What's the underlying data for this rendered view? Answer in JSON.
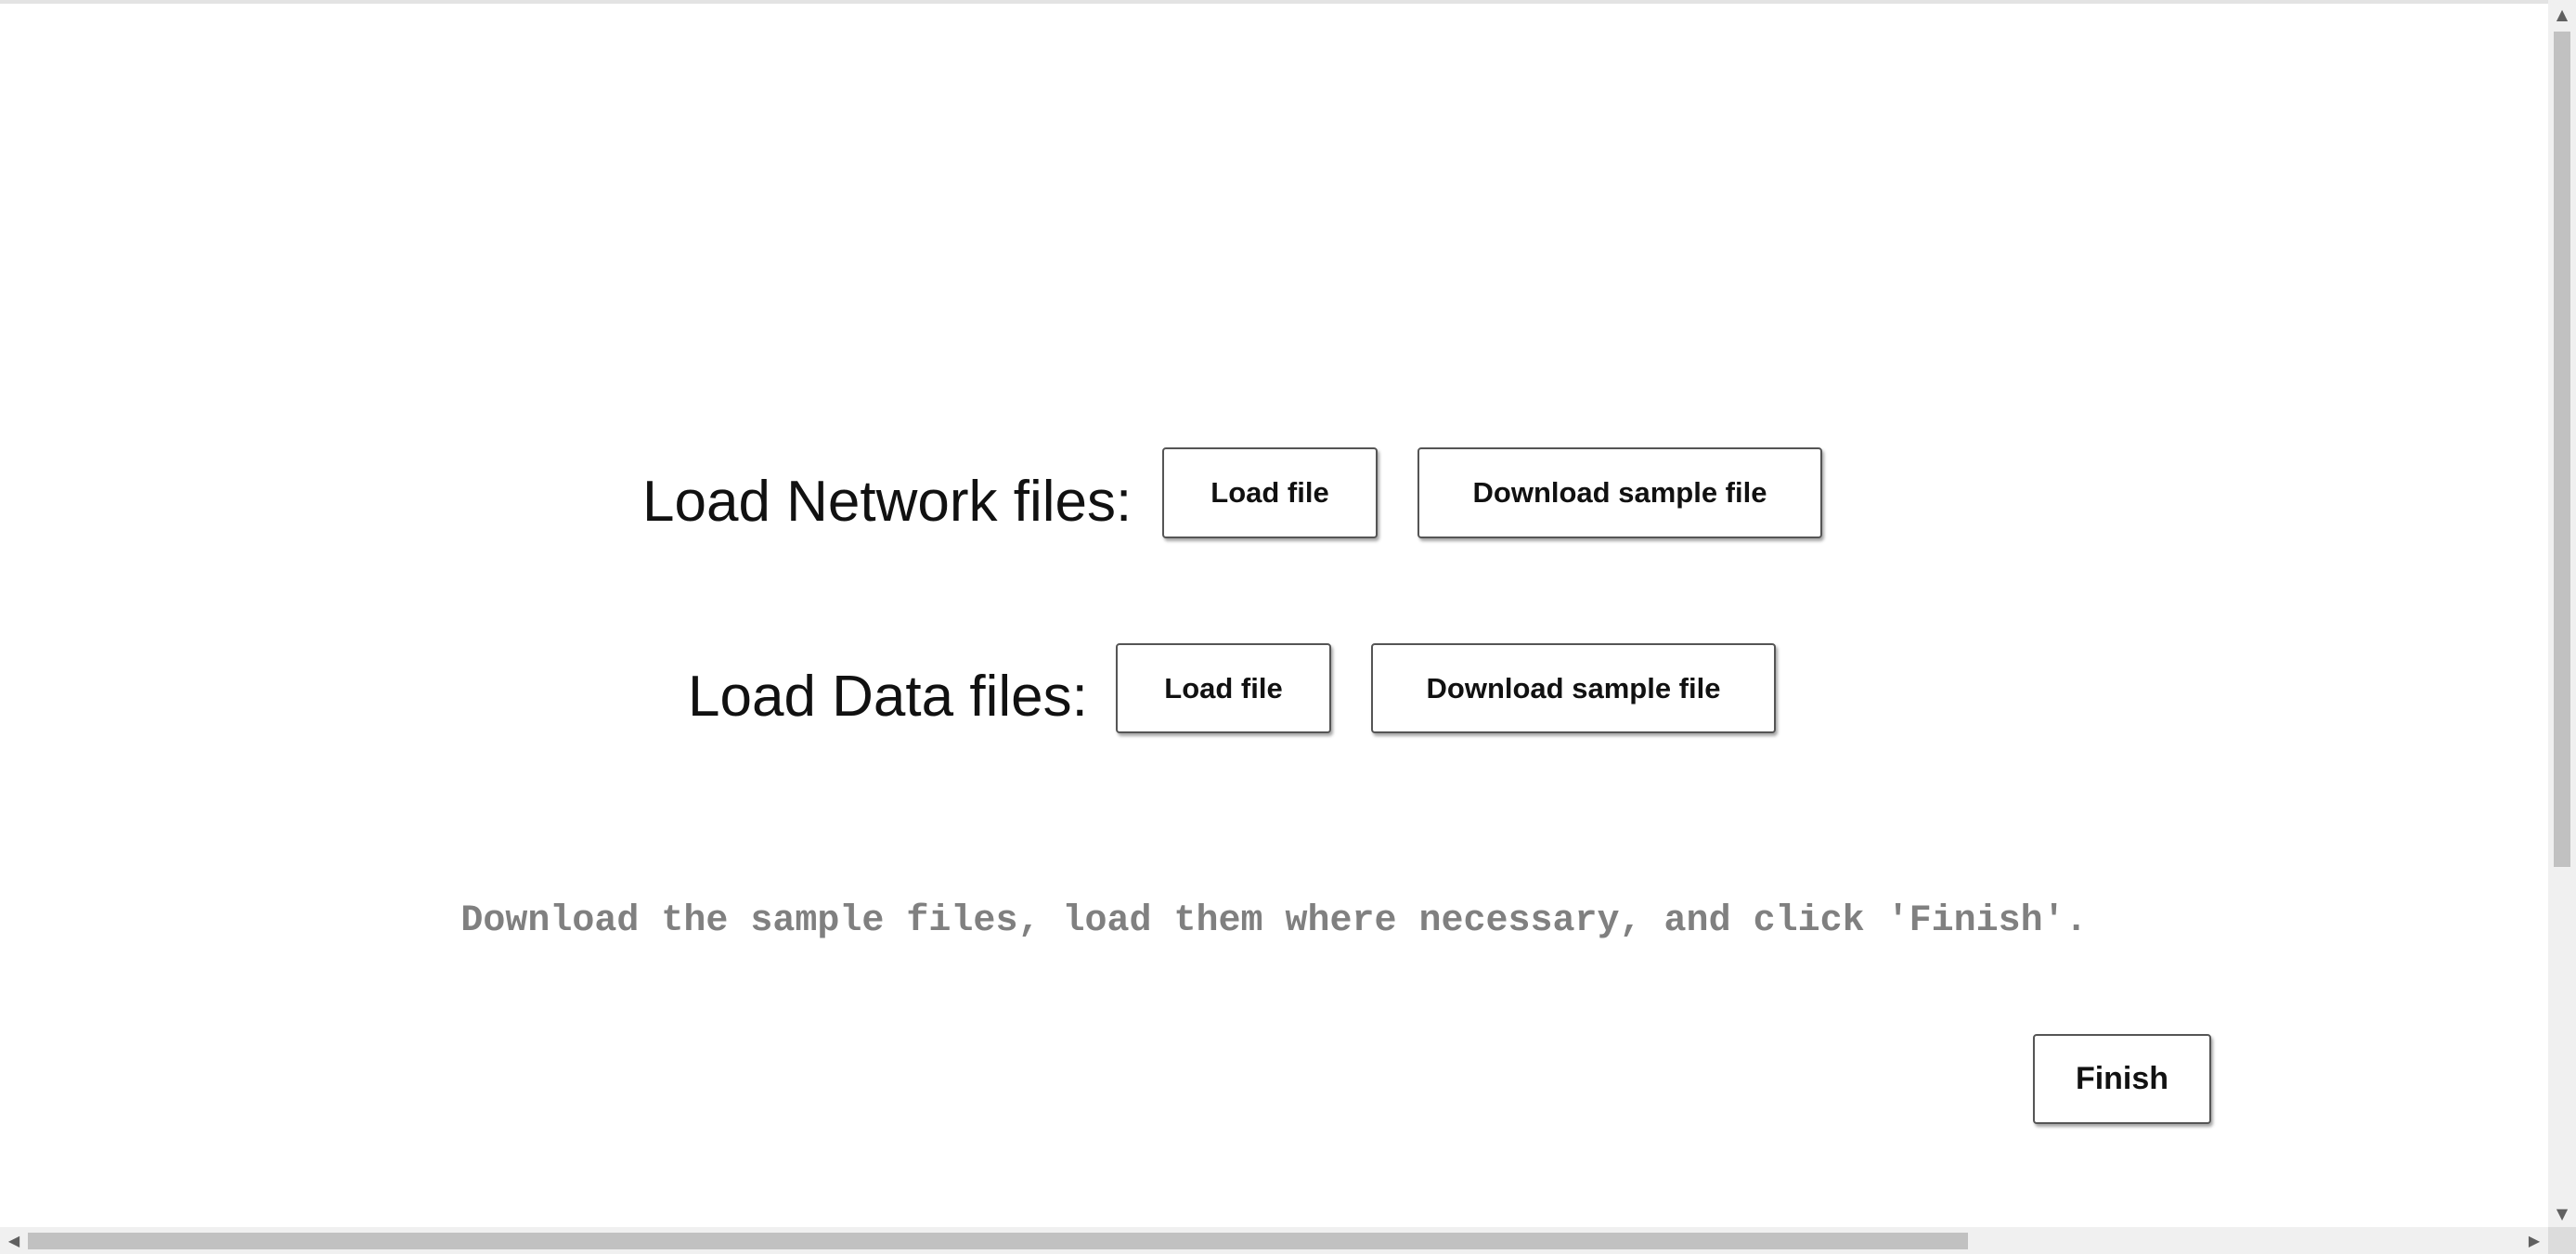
{
  "network": {
    "label": "Load Network files:",
    "load_button": "Load file",
    "download_button": "Download sample file"
  },
  "data": {
    "label": "Load Data files:",
    "load_button": "Load file",
    "download_button": "Download sample file"
  },
  "instruction": "Download the sample files, load them where necessary, and click 'Finish'.",
  "finish_button": "Finish",
  "scrollbars": {
    "up_icon": "▲",
    "down_icon": "▼",
    "left_icon": "◀",
    "right_icon": "▶"
  }
}
